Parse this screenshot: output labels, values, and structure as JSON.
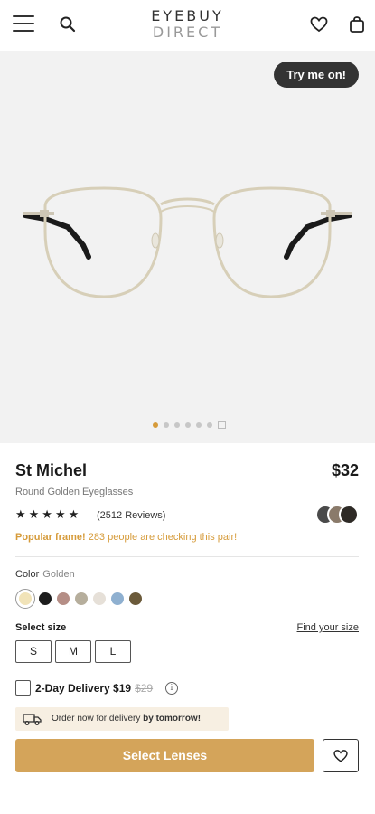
{
  "header": {
    "logo_line1": "EYEBUY",
    "logo_line2": "DIRECT",
    "icons": [
      "menu-icon",
      "search-icon",
      "heart-icon",
      "bag-icon"
    ]
  },
  "hero": {
    "try_on_label": "Try me on!",
    "image_count": 6,
    "active_image": 1
  },
  "product": {
    "name": "St Michel",
    "price": "$32",
    "subtitle": "Round Golden Eyeglasses",
    "rating": 5,
    "stars": "★★★★★",
    "reviews": "(2512 Reviews)",
    "popular_label": "Popular frame!",
    "popular_text": " 283 people are checking this pair!"
  },
  "color": {
    "label": "Color",
    "value": "Golden",
    "swatches": [
      "#f1e3b8",
      "#1c1c1c",
      "#b58e86",
      "#b6ae9c",
      "#e6e0d8",
      "#8fb0d0",
      "#6b5a3a"
    ]
  },
  "size": {
    "label": "Select size",
    "find_label": "Find your size",
    "options": [
      "S",
      "M",
      "L"
    ]
  },
  "delivery": {
    "label": "2-Day Delivery $19",
    "old_price": "$29",
    "info_glyph": "i",
    "banner_prefix": "Order now for delivery ",
    "banner_bold": "by tomorrow!"
  },
  "cta": {
    "select_label": "Select Lenses"
  },
  "colors": {
    "accent": "#d4a45a",
    "popular": "#d69b3a"
  }
}
